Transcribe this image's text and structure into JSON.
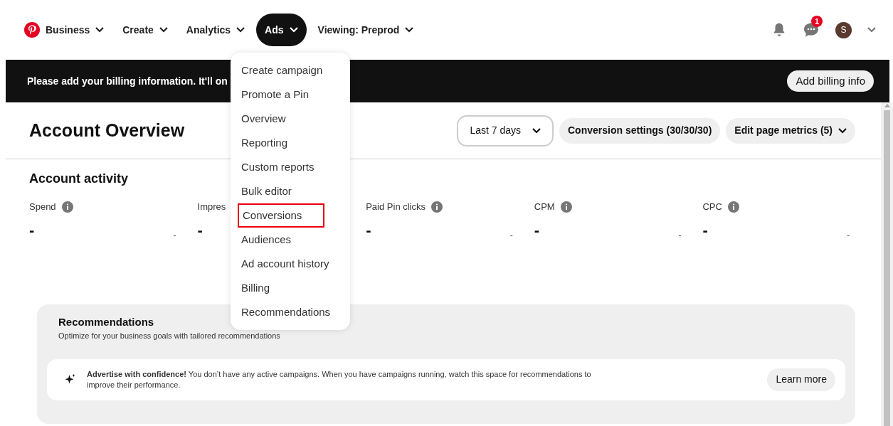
{
  "nav": {
    "items": [
      {
        "label": "Business",
        "kind": "logo",
        "selected": false
      },
      {
        "label": "Create",
        "kind": "plain",
        "selected": false
      },
      {
        "label": "Analytics",
        "kind": "plain",
        "selected": false
      },
      {
        "label": "Ads",
        "kind": "plain",
        "selected": true
      },
      {
        "label": "Viewing: Preprod",
        "kind": "plain",
        "selected": false
      }
    ],
    "notification_badge": "1",
    "avatar": "S"
  },
  "banner": {
    "text": "Please add your billing information. It'll on",
    "button": "Add billing info"
  },
  "ads_menu": [
    {
      "label": "Create campaign",
      "selected": false
    },
    {
      "label": "Promote a Pin",
      "selected": false
    },
    {
      "label": "Overview",
      "selected": false
    },
    {
      "label": "Reporting",
      "selected": false
    },
    {
      "label": "Custom reports",
      "selected": false
    },
    {
      "label": "Bulk editor",
      "selected": false
    },
    {
      "label": "Conversions",
      "selected": true
    },
    {
      "label": "Audiences",
      "selected": false
    },
    {
      "label": "Ad account history",
      "selected": false
    },
    {
      "label": "Billing",
      "selected": false
    },
    {
      "label": "Recommendations",
      "selected": false
    }
  ],
  "page": {
    "title": "Account Overview",
    "date_range": "Last 7 days",
    "conversion_settings": "Conversion settings (30/30/30)",
    "edit_metrics": "Edit page metrics (5)"
  },
  "activity": {
    "title": "Account activity",
    "metrics": [
      {
        "label": "Spend",
        "info": true,
        "value": "-",
        "change": "-"
      },
      {
        "label": "Impres",
        "info": false,
        "value": "-"
      },
      {
        "label": "Paid Pin clicks",
        "info": true,
        "value": "-",
        "change": "-"
      },
      {
        "label": "CPM",
        "info": true,
        "value": "-",
        "change": "-"
      },
      {
        "label": "CPC",
        "info": true,
        "value": "-",
        "change": "-"
      }
    ]
  },
  "recommendations": {
    "title": "Recommendations",
    "subtitle": "Optimize for your business goals with tailored recommendations",
    "card_text": "**Advertise with confidence!** You don’t have any active campaigns. When you have campaigns running, watch this space for recommendations to improve their performance.",
    "card_button": "Learn more"
  }
}
